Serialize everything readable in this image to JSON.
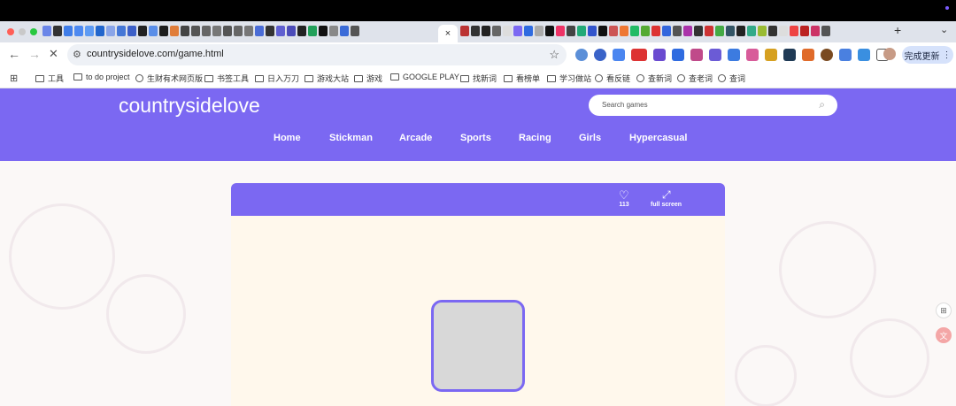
{
  "browser": {
    "tabs_active_close": "×",
    "new_tab": "+",
    "tab_menu": "⌄",
    "url": "countrysidelove.com/game.html",
    "update_button": "完成更新",
    "update_menu": "⋮"
  },
  "bookmarks": {
    "items": [
      "工具",
      "to do project",
      "生财有术网页版",
      "书签工具",
      "日入万刀",
      "游戏大站",
      "游戏",
      "GOOGLE PLAY",
      "找新词",
      "看榜单",
      "学习做站",
      "看反链",
      "查新词",
      "查老词",
      "查词"
    ]
  },
  "site": {
    "logo": "countrysidelove",
    "search_placeholder": "Search games",
    "nav": [
      "Home",
      "Stickman",
      "Arcade",
      "Sports",
      "Racing",
      "Girls",
      "Hypercasual"
    ]
  },
  "game": {
    "likes": "113",
    "fullscreen_label": "full screen"
  },
  "colors": {
    "brand": "#7b68f2",
    "background": "#fbf8f7",
    "game_area": "#fff8ec"
  }
}
